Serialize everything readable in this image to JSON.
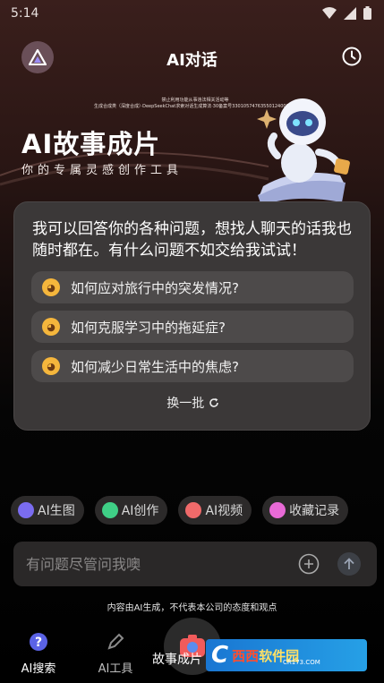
{
  "status_bar": {
    "time": "5:14"
  },
  "header": {
    "title": "AI对话"
  },
  "banner": {
    "notice_line1": "禁止利用功能从事违法相关活动等",
    "notice_line2": "生成合成类（深度合成）·DeepSeekChat求索对话生成算法·30备案号330105747635501240017号",
    "title": "AI故事成片",
    "subtitle": "你的专属灵感创作工具"
  },
  "chat": {
    "intro": "我可以回答你的各种问题，想找人聊天的话我也随时都在。有什么问题不如交给我试试！",
    "suggestions": [
      {
        "label": "如何应对旅行中的突发情况?"
      },
      {
        "label": "如何克服学习中的拖延症?"
      },
      {
        "label": "如何减少日常生活中的焦虑?"
      }
    ],
    "refresh_label": "换一批"
  },
  "quick_actions": [
    {
      "label": "AI生图",
      "color": "#7a6cf0"
    },
    {
      "label": "AI创作",
      "color": "#3fcf86"
    },
    {
      "label": "AI视频",
      "color": "#f06a6a"
    },
    {
      "label": "收藏记录",
      "color": "#e86ad6"
    }
  ],
  "input": {
    "placeholder": "有问题尽管问我噢"
  },
  "disclaimer": "内容由AI生成，不代表本公司的态度和观点",
  "nav": {
    "search_label": "AI搜索",
    "tools_label": "AI工具",
    "center_label": "故事成片"
  },
  "watermark": {
    "c": "C",
    "brand_xx": "西西",
    "brand_rest": "软件园",
    "url": "CR173.COM"
  }
}
